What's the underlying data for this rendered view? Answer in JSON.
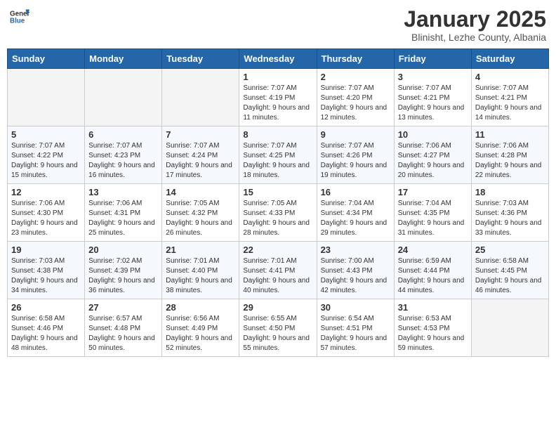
{
  "logo": {
    "general": "General",
    "blue": "Blue"
  },
  "title": "January 2025",
  "subtitle": "Blinisht, Lezhe County, Albania",
  "weekdays": [
    "Sunday",
    "Monday",
    "Tuesday",
    "Wednesday",
    "Thursday",
    "Friday",
    "Saturday"
  ],
  "weeks": [
    [
      {
        "day": "",
        "sunrise": "",
        "sunset": "",
        "daylight": ""
      },
      {
        "day": "",
        "sunrise": "",
        "sunset": "",
        "daylight": ""
      },
      {
        "day": "",
        "sunrise": "",
        "sunset": "",
        "daylight": ""
      },
      {
        "day": "1",
        "sunrise": "Sunrise: 7:07 AM",
        "sunset": "Sunset: 4:19 PM",
        "daylight": "Daylight: 9 hours and 11 minutes."
      },
      {
        "day": "2",
        "sunrise": "Sunrise: 7:07 AM",
        "sunset": "Sunset: 4:20 PM",
        "daylight": "Daylight: 9 hours and 12 minutes."
      },
      {
        "day": "3",
        "sunrise": "Sunrise: 7:07 AM",
        "sunset": "Sunset: 4:21 PM",
        "daylight": "Daylight: 9 hours and 13 minutes."
      },
      {
        "day": "4",
        "sunrise": "Sunrise: 7:07 AM",
        "sunset": "Sunset: 4:21 PM",
        "daylight": "Daylight: 9 hours and 14 minutes."
      }
    ],
    [
      {
        "day": "5",
        "sunrise": "Sunrise: 7:07 AM",
        "sunset": "Sunset: 4:22 PM",
        "daylight": "Daylight: 9 hours and 15 minutes."
      },
      {
        "day": "6",
        "sunrise": "Sunrise: 7:07 AM",
        "sunset": "Sunset: 4:23 PM",
        "daylight": "Daylight: 9 hours and 16 minutes."
      },
      {
        "day": "7",
        "sunrise": "Sunrise: 7:07 AM",
        "sunset": "Sunset: 4:24 PM",
        "daylight": "Daylight: 9 hours and 17 minutes."
      },
      {
        "day": "8",
        "sunrise": "Sunrise: 7:07 AM",
        "sunset": "Sunset: 4:25 PM",
        "daylight": "Daylight: 9 hours and 18 minutes."
      },
      {
        "day": "9",
        "sunrise": "Sunrise: 7:07 AM",
        "sunset": "Sunset: 4:26 PM",
        "daylight": "Daylight: 9 hours and 19 minutes."
      },
      {
        "day": "10",
        "sunrise": "Sunrise: 7:06 AM",
        "sunset": "Sunset: 4:27 PM",
        "daylight": "Daylight: 9 hours and 20 minutes."
      },
      {
        "day": "11",
        "sunrise": "Sunrise: 7:06 AM",
        "sunset": "Sunset: 4:28 PM",
        "daylight": "Daylight: 9 hours and 22 minutes."
      }
    ],
    [
      {
        "day": "12",
        "sunrise": "Sunrise: 7:06 AM",
        "sunset": "Sunset: 4:30 PM",
        "daylight": "Daylight: 9 hours and 23 minutes."
      },
      {
        "day": "13",
        "sunrise": "Sunrise: 7:06 AM",
        "sunset": "Sunset: 4:31 PM",
        "daylight": "Daylight: 9 hours and 25 minutes."
      },
      {
        "day": "14",
        "sunrise": "Sunrise: 7:05 AM",
        "sunset": "Sunset: 4:32 PM",
        "daylight": "Daylight: 9 hours and 26 minutes."
      },
      {
        "day": "15",
        "sunrise": "Sunrise: 7:05 AM",
        "sunset": "Sunset: 4:33 PM",
        "daylight": "Daylight: 9 hours and 28 minutes."
      },
      {
        "day": "16",
        "sunrise": "Sunrise: 7:04 AM",
        "sunset": "Sunset: 4:34 PM",
        "daylight": "Daylight: 9 hours and 29 minutes."
      },
      {
        "day": "17",
        "sunrise": "Sunrise: 7:04 AM",
        "sunset": "Sunset: 4:35 PM",
        "daylight": "Daylight: 9 hours and 31 minutes."
      },
      {
        "day": "18",
        "sunrise": "Sunrise: 7:03 AM",
        "sunset": "Sunset: 4:36 PM",
        "daylight": "Daylight: 9 hours and 33 minutes."
      }
    ],
    [
      {
        "day": "19",
        "sunrise": "Sunrise: 7:03 AM",
        "sunset": "Sunset: 4:38 PM",
        "daylight": "Daylight: 9 hours and 34 minutes."
      },
      {
        "day": "20",
        "sunrise": "Sunrise: 7:02 AM",
        "sunset": "Sunset: 4:39 PM",
        "daylight": "Daylight: 9 hours and 36 minutes."
      },
      {
        "day": "21",
        "sunrise": "Sunrise: 7:01 AM",
        "sunset": "Sunset: 4:40 PM",
        "daylight": "Daylight: 9 hours and 38 minutes."
      },
      {
        "day": "22",
        "sunrise": "Sunrise: 7:01 AM",
        "sunset": "Sunset: 4:41 PM",
        "daylight": "Daylight: 9 hours and 40 minutes."
      },
      {
        "day": "23",
        "sunrise": "Sunrise: 7:00 AM",
        "sunset": "Sunset: 4:43 PM",
        "daylight": "Daylight: 9 hours and 42 minutes."
      },
      {
        "day": "24",
        "sunrise": "Sunrise: 6:59 AM",
        "sunset": "Sunset: 4:44 PM",
        "daylight": "Daylight: 9 hours and 44 minutes."
      },
      {
        "day": "25",
        "sunrise": "Sunrise: 6:58 AM",
        "sunset": "Sunset: 4:45 PM",
        "daylight": "Daylight: 9 hours and 46 minutes."
      }
    ],
    [
      {
        "day": "26",
        "sunrise": "Sunrise: 6:58 AM",
        "sunset": "Sunset: 4:46 PM",
        "daylight": "Daylight: 9 hours and 48 minutes."
      },
      {
        "day": "27",
        "sunrise": "Sunrise: 6:57 AM",
        "sunset": "Sunset: 4:48 PM",
        "daylight": "Daylight: 9 hours and 50 minutes."
      },
      {
        "day": "28",
        "sunrise": "Sunrise: 6:56 AM",
        "sunset": "Sunset: 4:49 PM",
        "daylight": "Daylight: 9 hours and 52 minutes."
      },
      {
        "day": "29",
        "sunrise": "Sunrise: 6:55 AM",
        "sunset": "Sunset: 4:50 PM",
        "daylight": "Daylight: 9 hours and 55 minutes."
      },
      {
        "day": "30",
        "sunrise": "Sunrise: 6:54 AM",
        "sunset": "Sunset: 4:51 PM",
        "daylight": "Daylight: 9 hours and 57 minutes."
      },
      {
        "day": "31",
        "sunrise": "Sunrise: 6:53 AM",
        "sunset": "Sunset: 4:53 PM",
        "daylight": "Daylight: 9 hours and 59 minutes."
      },
      {
        "day": "",
        "sunrise": "",
        "sunset": "",
        "daylight": ""
      }
    ]
  ]
}
